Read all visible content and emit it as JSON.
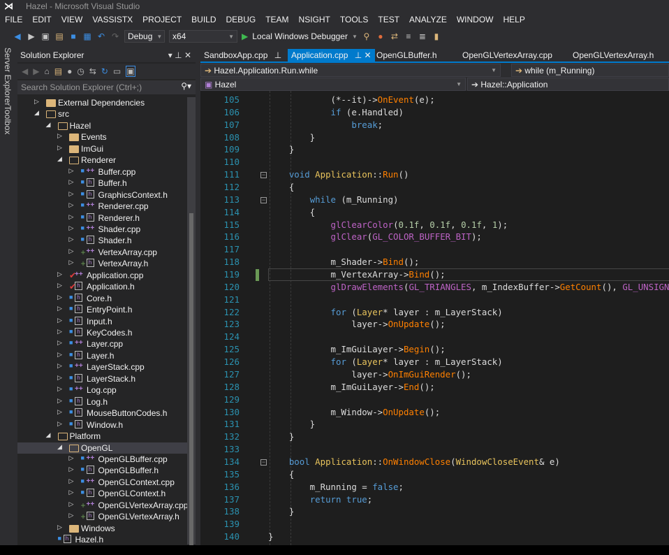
{
  "window": {
    "title": "Hazel - Microsoft Visual Studio"
  },
  "menu": [
    "FILE",
    "EDIT",
    "VIEW",
    "VASSISTX",
    "PROJECT",
    "BUILD",
    "DEBUG",
    "TEAM",
    "NSIGHT",
    "TOOLS",
    "TEST",
    "ANALYZE",
    "WINDOW",
    "HELP"
  ],
  "toolbar": {
    "config": "Debug",
    "platform": "x64",
    "debugger": "Local Windows Debugger"
  },
  "side_tabs": [
    "Server Explorer",
    "Toolbox"
  ],
  "solution_explorer": {
    "title": "Solution Explorer",
    "search_placeholder": "Search Solution Explorer (Ctrl+;)",
    "items": [
      {
        "name": "External Dependencies",
        "level": 0,
        "kind": "ext",
        "exp": "c",
        "status": ""
      },
      {
        "name": "src",
        "level": 0,
        "kind": "ofolder",
        "exp": "e",
        "status": ""
      },
      {
        "name": "Hazel",
        "level": 1,
        "kind": "ofolder",
        "exp": "e",
        "status": ""
      },
      {
        "name": "Events",
        "level": 2,
        "kind": "folder",
        "exp": "c",
        "status": ""
      },
      {
        "name": "ImGui",
        "level": 2,
        "kind": "folder",
        "exp": "c",
        "status": ""
      },
      {
        "name": "Renderer",
        "level": 2,
        "kind": "ofolder",
        "exp": "e",
        "status": ""
      },
      {
        "name": "Buffer.cpp",
        "level": 3,
        "kind": "cpp",
        "exp": "c",
        "status": "lock"
      },
      {
        "name": "Buffer.h",
        "level": 3,
        "kind": "h",
        "exp": "c",
        "status": "lock"
      },
      {
        "name": "GraphicsContext.h",
        "level": 3,
        "kind": "h",
        "exp": "c",
        "status": "lock"
      },
      {
        "name": "Renderer.cpp",
        "level": 3,
        "kind": "cpp",
        "exp": "c",
        "status": "lock"
      },
      {
        "name": "Renderer.h",
        "level": 3,
        "kind": "h",
        "exp": "c",
        "status": "lock"
      },
      {
        "name": "Shader.cpp",
        "level": 3,
        "kind": "cpp",
        "exp": "c",
        "status": "lock"
      },
      {
        "name": "Shader.h",
        "level": 3,
        "kind": "h",
        "exp": "c",
        "status": "lock"
      },
      {
        "name": "VertexArray.cpp",
        "level": 3,
        "kind": "cpp",
        "exp": "c",
        "status": "plus"
      },
      {
        "name": "VertexArray.h",
        "level": 3,
        "kind": "h",
        "exp": "c",
        "status": "plus"
      },
      {
        "name": "Application.cpp",
        "level": 2,
        "kind": "cpp",
        "exp": "c",
        "status": "check"
      },
      {
        "name": "Application.h",
        "level": 2,
        "kind": "h",
        "exp": "c",
        "status": "check"
      },
      {
        "name": "Core.h",
        "level": 2,
        "kind": "h",
        "exp": "c",
        "status": "lock"
      },
      {
        "name": "EntryPoint.h",
        "level": 2,
        "kind": "h",
        "exp": "c",
        "status": "lock"
      },
      {
        "name": "Input.h",
        "level": 2,
        "kind": "h",
        "exp": "c",
        "status": "lock"
      },
      {
        "name": "KeyCodes.h",
        "level": 2,
        "kind": "h",
        "exp": "c",
        "status": "lock"
      },
      {
        "name": "Layer.cpp",
        "level": 2,
        "kind": "cpp",
        "exp": "c",
        "status": "lock"
      },
      {
        "name": "Layer.h",
        "level": 2,
        "kind": "h",
        "exp": "c",
        "status": "lock"
      },
      {
        "name": "LayerStack.cpp",
        "level": 2,
        "kind": "cpp",
        "exp": "c",
        "status": "lock"
      },
      {
        "name": "LayerStack.h",
        "level": 2,
        "kind": "h",
        "exp": "c",
        "status": "lock"
      },
      {
        "name": "Log.cpp",
        "level": 2,
        "kind": "cpp",
        "exp": "c",
        "status": "lock"
      },
      {
        "name": "Log.h",
        "level": 2,
        "kind": "h",
        "exp": "c",
        "status": "lock"
      },
      {
        "name": "MouseButtonCodes.h",
        "level": 2,
        "kind": "h",
        "exp": "c",
        "status": "lock"
      },
      {
        "name": "Window.h",
        "level": 2,
        "kind": "h",
        "exp": "c",
        "status": "lock"
      },
      {
        "name": "Platform",
        "level": 1,
        "kind": "ofolder",
        "exp": "e",
        "status": ""
      },
      {
        "name": "OpenGL",
        "level": 2,
        "kind": "ofolder",
        "exp": "e",
        "status": "",
        "selected": true
      },
      {
        "name": "OpenGLBuffer.cpp",
        "level": 3,
        "kind": "cpp",
        "exp": "c",
        "status": "lock"
      },
      {
        "name": "OpenGLBuffer.h",
        "level": 3,
        "kind": "h",
        "exp": "c",
        "status": "lock"
      },
      {
        "name": "OpenGLContext.cpp",
        "level": 3,
        "kind": "cpp",
        "exp": "c",
        "status": "lock"
      },
      {
        "name": "OpenGLContext.h",
        "level": 3,
        "kind": "h",
        "exp": "c",
        "status": "lock"
      },
      {
        "name": "OpenGLVertexArray.cpp",
        "level": 3,
        "kind": "cpp",
        "exp": "c",
        "status": "plus"
      },
      {
        "name": "OpenGLVertexArray.h",
        "level": 3,
        "kind": "h",
        "exp": "c",
        "status": "plus"
      },
      {
        "name": "Windows",
        "level": 2,
        "kind": "folder",
        "exp": "c",
        "status": ""
      },
      {
        "name": "Hazel.h",
        "level": 1,
        "kind": "h",
        "exp": "",
        "status": "lock"
      }
    ]
  },
  "tabs": [
    {
      "label": "SandboxApp.cpp",
      "pinned": true
    },
    {
      "label": "Application.cpp",
      "pinned": true,
      "active": true
    },
    {
      "label": "OpenGLBuffer.h"
    },
    {
      "label": "OpenGLVertexArray.cpp"
    },
    {
      "label": "OpenGLVertexArray.h"
    }
  ],
  "nav": {
    "scope": "Hazel.Application.Run.while",
    "member": "while (m_Running)",
    "project": "Hazel",
    "class": "Hazel::Application"
  },
  "code": {
    "first_line": 105,
    "current_line": 119,
    "lines": [
      [
        [
          "            (*--it)->",
          "id"
        ],
        [
          "OnEvent",
          "fn"
        ],
        [
          "(e);",
          "id"
        ]
      ],
      [
        [
          "            ",
          "id"
        ],
        [
          "if",
          "kw"
        ],
        [
          " (e.Handled)",
          "id"
        ]
      ],
      [
        [
          "                ",
          "id"
        ],
        [
          "break",
          "kw"
        ],
        [
          ";",
          "id"
        ]
      ],
      [
        [
          "        }",
          "id"
        ]
      ],
      [
        [
          "    }",
          "id"
        ]
      ],
      [],
      [
        [
          "    ",
          "id"
        ],
        [
          "void",
          "kw"
        ],
        [
          " ",
          "id"
        ],
        [
          "Application",
          "type"
        ],
        [
          "::",
          "id"
        ],
        [
          "Run",
          "fn"
        ],
        [
          "()",
          "id"
        ]
      ],
      [
        [
          "    {",
          "id"
        ]
      ],
      [
        [
          "        ",
          "id"
        ],
        [
          "while",
          "kw"
        ],
        [
          " (m_Running)",
          "id"
        ]
      ],
      [
        [
          "        {",
          "id"
        ]
      ],
      [
        [
          "            ",
          "id"
        ],
        [
          "glClearColor",
          "mac"
        ],
        [
          "(",
          "id"
        ],
        [
          "0.1f",
          "num"
        ],
        [
          ", ",
          "id"
        ],
        [
          "0.1f",
          "num"
        ],
        [
          ", ",
          "id"
        ],
        [
          "0.1f",
          "num"
        ],
        [
          ", ",
          "id"
        ],
        [
          "1",
          "num"
        ],
        [
          ");",
          "id"
        ]
      ],
      [
        [
          "            ",
          "id"
        ],
        [
          "glClear",
          "mac"
        ],
        [
          "(",
          "id"
        ],
        [
          "GL_COLOR_BUFFER_BIT",
          "mac"
        ],
        [
          ");",
          "id"
        ]
      ],
      [],
      [
        [
          "            m_Shader->",
          "id"
        ],
        [
          "Bind",
          "fn"
        ],
        [
          "();",
          "id"
        ]
      ],
      [
        [
          "            m_VertexArray->",
          "id"
        ],
        [
          "Bind",
          "fn"
        ],
        [
          "();",
          "id"
        ]
      ],
      [
        [
          "            ",
          "id"
        ],
        [
          "glDrawElements",
          "mac"
        ],
        [
          "(",
          "id"
        ],
        [
          "GL_TRIANGLES",
          "mac"
        ],
        [
          ", m_IndexBuffer->",
          "id"
        ],
        [
          "GetCount",
          "fn"
        ],
        [
          "(), ",
          "id"
        ],
        [
          "GL_UNSIGN",
          "mac"
        ]
      ],
      [],
      [
        [
          "            ",
          "id"
        ],
        [
          "for",
          "kw"
        ],
        [
          " (",
          "id"
        ],
        [
          "Layer",
          "type"
        ],
        [
          "* layer : m_LayerStack)",
          "id"
        ]
      ],
      [
        [
          "                layer->",
          "id"
        ],
        [
          "OnUpdate",
          "fn"
        ],
        [
          "();",
          "id"
        ]
      ],
      [],
      [
        [
          "            m_ImGuiLayer->",
          "id"
        ],
        [
          "Begin",
          "fn"
        ],
        [
          "();",
          "id"
        ]
      ],
      [
        [
          "            ",
          "id"
        ],
        [
          "for",
          "kw"
        ],
        [
          " (",
          "id"
        ],
        [
          "Layer",
          "type"
        ],
        [
          "* layer : m_LayerStack)",
          "id"
        ]
      ],
      [
        [
          "                layer->",
          "id"
        ],
        [
          "OnImGuiRender",
          "fn"
        ],
        [
          "();",
          "id"
        ]
      ],
      [
        [
          "            m_ImGuiLayer->",
          "id"
        ],
        [
          "End",
          "fn"
        ],
        [
          "();",
          "id"
        ]
      ],
      [],
      [
        [
          "            m_Window->",
          "id"
        ],
        [
          "OnUpdate",
          "fn"
        ],
        [
          "();",
          "id"
        ]
      ],
      [
        [
          "        }",
          "id"
        ]
      ],
      [
        [
          "    }",
          "id"
        ]
      ],
      [],
      [
        [
          "    ",
          "id"
        ],
        [
          "bool",
          "kw"
        ],
        [
          " ",
          "id"
        ],
        [
          "Application",
          "type"
        ],
        [
          "::",
          "id"
        ],
        [
          "OnWindowClose",
          "fn"
        ],
        [
          "(",
          "id"
        ],
        [
          "WindowCloseEvent",
          "type"
        ],
        [
          "& e)",
          "id"
        ]
      ],
      [
        [
          "    {",
          "id"
        ]
      ],
      [
        [
          "        m_Running = ",
          "id"
        ],
        [
          "false",
          "kw"
        ],
        [
          ";",
          "id"
        ]
      ],
      [
        [
          "        ",
          "id"
        ],
        [
          "return",
          "kw"
        ],
        [
          " ",
          "id"
        ],
        [
          "true",
          "kw"
        ],
        [
          ";",
          "id"
        ]
      ],
      [
        [
          "    }",
          "id"
        ]
      ],
      [],
      [
        [
          "}",
          "id"
        ]
      ]
    ],
    "collapsible": [
      111,
      113,
      134
    ],
    "changed": [
      119
    ]
  }
}
